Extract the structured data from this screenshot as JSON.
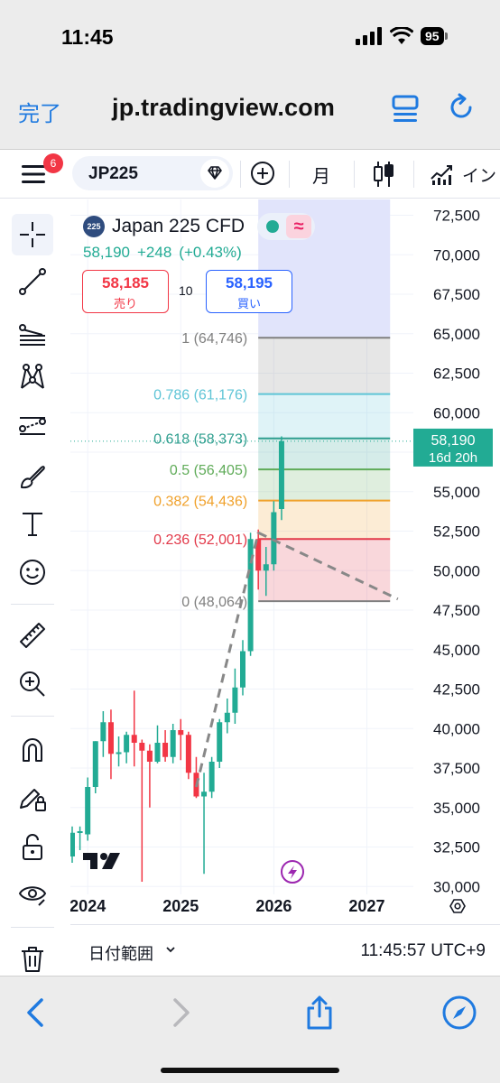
{
  "status_bar": {
    "time": "11:45",
    "battery": "95"
  },
  "browser": {
    "done_label": "完了",
    "url": "jp.tradingview.com"
  },
  "toolbar": {
    "badge_count": "6",
    "symbol": "JP225",
    "interval": "月",
    "indicator_label": "イン"
  },
  "legend": {
    "logo_text": "225",
    "title": "Japan 225 CFD",
    "last_price": "58,190",
    "change": "+248",
    "change_pct": "(+0.43%)",
    "status_icon": "≈"
  },
  "trade": {
    "sell_price": "58,185",
    "sell_label": "売り",
    "spread": "10",
    "buy_price": "58,195",
    "buy_label": "買い"
  },
  "chart_bottom": {
    "date_range_label": "日付範囲",
    "clock": "11:45:57 UTC+9"
  },
  "colors": {
    "up": "#22ab94",
    "down": "#f23645",
    "projection_bg": "#dfe3fb",
    "fib_1": "#808080",
    "fib_0786": "#5ec4d6",
    "fib_0618": "#2f9e8f",
    "fib_05": "#5fab58",
    "fib_0382": "#f0a12b",
    "fib_0236": "#e2394a",
    "fib_0": "#808080"
  },
  "chart_data": {
    "type": "candlestick",
    "interval": "monthly",
    "y_axis": {
      "ticks": [
        30000,
        32500,
        35000,
        37500,
        40000,
        42500,
        45000,
        47500,
        50000,
        52500,
        55000,
        57500,
        60000,
        62500,
        65000,
        67500,
        70000,
        72500
      ],
      "tick_labels": [
        "30,000",
        "32,500",
        "35,000",
        "37,500",
        "40,000",
        "42,500",
        "45,000",
        "47,500",
        "50,000",
        "52,500",
        "55,000",
        "57,500",
        "60,000",
        "62,500",
        "65,000",
        "67,500",
        "70,000",
        "72,500"
      ],
      "range": [
        29500,
        73500
      ]
    },
    "x_axis": {
      "tick_labels": [
        "2024",
        "2025",
        "2026",
        "2027"
      ],
      "range": [
        "2023-11",
        "2027-07"
      ]
    },
    "current_price": {
      "value": 58190,
      "label": "58,190",
      "countdown": "16d 20h"
    },
    "candles": [
      {
        "date": "2023-11",
        "open": 31900,
        "high": 33800,
        "low": 31500,
        "close": 33400
      },
      {
        "date": "2023-12",
        "open": 33400,
        "high": 33800,
        "low": 32300,
        "close": 33500
      },
      {
        "date": "2024-01",
        "open": 33300,
        "high": 36900,
        "low": 32900,
        "close": 36300
      },
      {
        "date": "2024-02",
        "open": 36300,
        "high": 39200,
        "low": 35900,
        "close": 39200
      },
      {
        "date": "2024-03",
        "open": 39200,
        "high": 41100,
        "low": 38200,
        "close": 40400
      },
      {
        "date": "2024-04",
        "open": 40400,
        "high": 41200,
        "low": 36800,
        "close": 38400
      },
      {
        "date": "2024-05",
        "open": 38400,
        "high": 39500,
        "low": 37600,
        "close": 38500
      },
      {
        "date": "2024-06",
        "open": 38500,
        "high": 39800,
        "low": 37800,
        "close": 39600
      },
      {
        "date": "2024-07",
        "open": 39600,
        "high": 42400,
        "low": 37600,
        "close": 39100
      },
      {
        "date": "2024-08",
        "open": 39100,
        "high": 39300,
        "low": 30300,
        "close": 38600
      },
      {
        "date": "2024-09",
        "open": 38600,
        "high": 39000,
        "low": 35000,
        "close": 37900
      },
      {
        "date": "2024-10",
        "open": 37900,
        "high": 40200,
        "low": 37800,
        "close": 39100
      },
      {
        "date": "2024-11",
        "open": 39100,
        "high": 39900,
        "low": 37900,
        "close": 38200
      },
      {
        "date": "2024-12",
        "open": 38200,
        "high": 40300,
        "low": 37800,
        "close": 39900
      },
      {
        "date": "2025-01",
        "open": 39900,
        "high": 40600,
        "low": 38000,
        "close": 39600
      },
      {
        "date": "2025-02",
        "open": 39600,
        "high": 39800,
        "low": 36800,
        "close": 37200
      },
      {
        "date": "2025-03",
        "open": 37200,
        "high": 38200,
        "low": 35600,
        "close": 35700
      },
      {
        "date": "2025-04",
        "open": 35700,
        "high": 37200,
        "low": 30800,
        "close": 36000
      },
      {
        "date": "2025-05",
        "open": 36000,
        "high": 38200,
        "low": 35600,
        "close": 37900
      },
      {
        "date": "2025-06",
        "open": 37900,
        "high": 40600,
        "low": 37500,
        "close": 40400
      },
      {
        "date": "2025-07",
        "open": 40400,
        "high": 41900,
        "low": 39700,
        "close": 41000
      },
      {
        "date": "2025-08",
        "open": 41000,
        "high": 43800,
        "low": 40300,
        "close": 42600
      },
      {
        "date": "2025-09",
        "open": 42600,
        "high": 45600,
        "low": 42100,
        "close": 44900
      },
      {
        "date": "2025-10",
        "open": 44900,
        "high": 52400,
        "low": 44600,
        "close": 52000
      },
      {
        "date": "2025-11",
        "open": 52000,
        "high": 52600,
        "low": 48800,
        "close": 50000
      },
      {
        "date": "2025-12",
        "open": 50000,
        "high": 51500,
        "low": 48400,
        "close": 50400
      },
      {
        "date": "2026-01",
        "open": 50400,
        "high": 54400,
        "low": 50000,
        "close": 53700
      },
      {
        "date": "2026-02",
        "open": 53900,
        "high": 58500,
        "low": 53200,
        "close": 58190
      }
    ],
    "fibonacci": {
      "levels": [
        {
          "ratio": "1",
          "price": 64746,
          "label": "1 (64,746)",
          "color": "#808080"
        },
        {
          "ratio": "0.786",
          "price": 61176,
          "label": "0.786 (61,176)",
          "color": "#5ec4d6"
        },
        {
          "ratio": "0.618",
          "price": 58373,
          "label": "0.618 (58,373)",
          "color": "#2f9e8f"
        },
        {
          "ratio": "0.5",
          "price": 56405,
          "label": "0.5 (56,405)",
          "color": "#5fab58"
        },
        {
          "ratio": "0.382",
          "price": 54436,
          "label": "0.382 (54,436)",
          "color": "#f0a12b"
        },
        {
          "ratio": "0.236",
          "price": 52001,
          "label": "0.236 (52,001)",
          "color": "#e2394a"
        },
        {
          "ratio": "0",
          "price": 48064,
          "label": "0 (48,064)",
          "color": "#808080"
        }
      ],
      "start_date": "2025-11",
      "end_date": "2027-04"
    },
    "trend_lines": [
      {
        "from": {
          "date": "2025-03",
          "price": 36300
        },
        "to": {
          "date": "2025-11",
          "price": 52400
        }
      },
      {
        "from": {
          "date": "2025-11",
          "price": 52400
        },
        "to": {
          "date": "2027-05",
          "price": 48200
        }
      }
    ]
  }
}
